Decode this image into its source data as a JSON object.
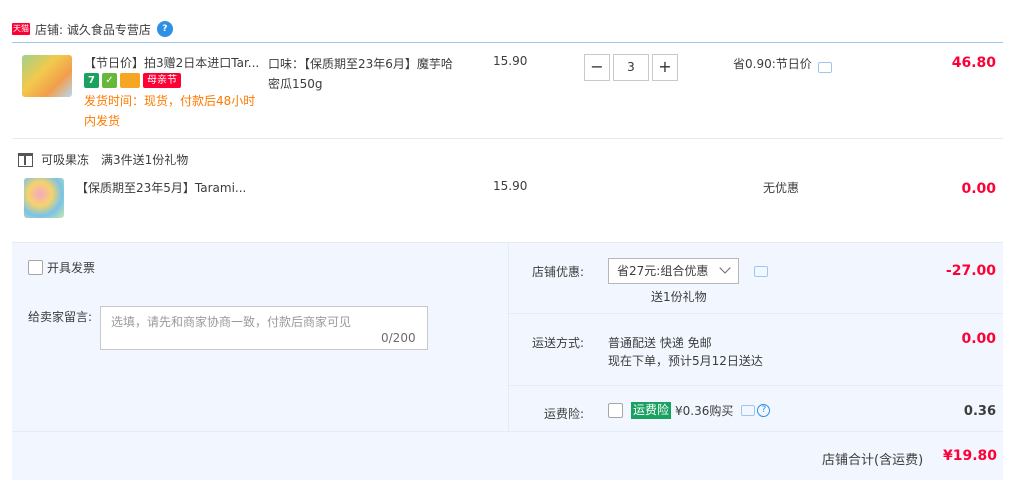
{
  "shop": {
    "badge": "天猫",
    "label": "店铺: 诚久食品专营店",
    "chat_badge": "?"
  },
  "item1": {
    "title": "【节日价】拍3赠2日本进口Tar...",
    "badges": {
      "seven": "7",
      "shield": "✓",
      "festival": "母亲节"
    },
    "ship_note": "发货时间：现货，付款后48小时内发货",
    "sku": "口味：【保质期至23年6月】魔芋哈密瓜150g",
    "price": "15.90",
    "qty_minus": "−",
    "qty_value": "3",
    "qty_plus": "+",
    "save": "省0.90:节日价",
    "total": "46.80"
  },
  "gift": {
    "group_name": "可吸果冻",
    "rule": "满3件送1份礼物",
    "item_title": "【保质期至23年5月】Tarami...",
    "price": "15.90",
    "discount": "无优惠",
    "total": "0.00"
  },
  "summary": {
    "invoice_label": "开具发票",
    "message_label": "给卖家留言:",
    "message_placeholder": "选填，请先和商家协商一致，付款后商家可见",
    "message_count": "0/200",
    "discount_label": "店铺优惠:",
    "discount_select": "省27元:组合优惠",
    "discount_sub": "送1份礼物",
    "discount_value": "-27.00",
    "shipping_label": "运送方式:",
    "shipping_line1": "普通配送 快递 免邮",
    "shipping_line2": "现在下单，预计5月12日送达",
    "shipping_value": "0.00",
    "insurance_label": "运费险:",
    "insurance_tag": "运费险",
    "insurance_text": "¥0.36购买",
    "insurance_value": "0.36"
  },
  "footer": {
    "label": "店铺合计(含运费)",
    "value": "¥19.80"
  }
}
